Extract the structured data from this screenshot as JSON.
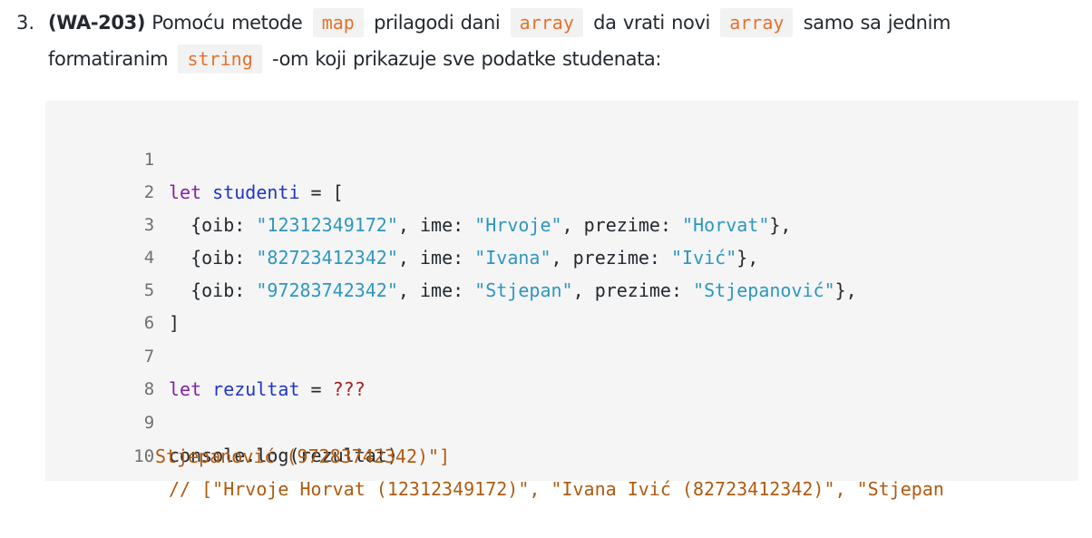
{
  "task": {
    "number": "3.",
    "id": "(WA-203)",
    "text_1": " Pomoću metode ",
    "code_map": "map",
    "text_2": " prilagodi dani ",
    "code_array_1": "array",
    "text_3": " da vrati novi ",
    "code_array_2": "array",
    "text_4": " samo sa jednim formatiranim ",
    "code_string": "string",
    "text_5": " -om koji prikazuje sve podatke studenata:"
  },
  "code": {
    "line_numbers": [
      "1",
      "2",
      "3",
      "4",
      "5",
      "6",
      "7",
      "8",
      "9",
      "10"
    ],
    "line1": {
      "kw": "let",
      "var": "studenti",
      "rest": " = ["
    },
    "students": [
      {
        "oib": "\"12312349172\"",
        "ime": "\"Hrvoje\"",
        "prezime": "\"Horvat\""
      },
      {
        "oib": "\"82723412342\"",
        "ime": "\"Ivana\"",
        "prezime": "\"Ivić\""
      },
      {
        "oib": "\"97283742342\"",
        "ime": "\"Stjepan\"",
        "prezime": "\"Stjepanović\""
      }
    ],
    "key_oib": "{oib",
    "key_ime": "ime",
    "key_prezime": "prezime",
    "line5": "]",
    "line7": {
      "kw": "let",
      "var": "rezultat",
      "op": " = ",
      "unknown": "???"
    },
    "line9": "console.log(rezultat)",
    "line10_a": "// [\"Hrvoje Horvat (12312349172)\", \"Ivana Ivić (82723412342)\", \"Stjepan",
    "line10_b": "Stjepanović (97283742342)\"]"
  }
}
